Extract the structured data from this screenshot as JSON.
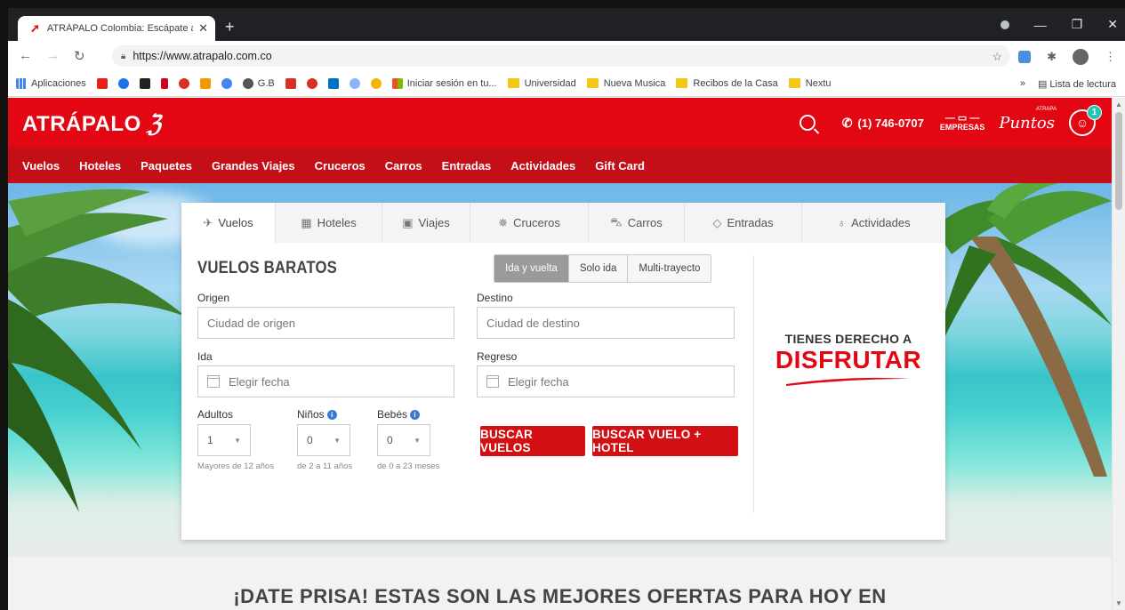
{
  "browser": {
    "tab_title": "ATRÁPALO Colombia: Escápate a",
    "tab_close": "✕",
    "new_tab": "+",
    "url": "https://www.atrapalo.com.co",
    "bookmarks": [
      {
        "label": "Aplicaciones",
        "color": "#4285f4"
      },
      {
        "label": "",
        "color": "#e62117"
      },
      {
        "label": "",
        "color": "#1a73e8"
      },
      {
        "label": "",
        "color": "#222222"
      },
      {
        "label": "",
        "color": "#d0021b"
      },
      {
        "label": "",
        "color": "#d93025"
      },
      {
        "label": "",
        "color": "#f29900"
      },
      {
        "label": "",
        "color": "#4285f4"
      },
      {
        "label": "G.B",
        "color": "#555555"
      },
      {
        "label": "",
        "color": "#d93025"
      },
      {
        "label": "",
        "color": "#d93025"
      },
      {
        "label": "",
        "color": "#0072c6"
      },
      {
        "label": "",
        "color": "#8ab4f8"
      },
      {
        "label": "",
        "color": "#f4b400"
      },
      {
        "label": "Iniciar sesión en tu...",
        "color": "#f25022"
      }
    ],
    "bookmark_folders": [
      "Universidad",
      "Nueva Musica",
      "Recibos de la Casa",
      "Nextu"
    ],
    "more_bookmarks": "»",
    "reading_list": "Lista de lectura"
  },
  "site": {
    "logo": "ATRÁPALO",
    "phone": "(1) 746-0707",
    "empresas": "EMPRESAS",
    "puntos": "Puntos",
    "puntos_sup": "ATRAPA",
    "notifications": "1",
    "nav": [
      "Vuelos",
      "Hoteles",
      "Paquetes",
      "Grandes Viajes",
      "Cruceros",
      "Carros",
      "Entradas",
      "Actividades",
      "Gift Card"
    ]
  },
  "widget": {
    "tabs": [
      {
        "label": "Vuelos",
        "icon": "plane-icon"
      },
      {
        "label": "Hoteles",
        "icon": "hotel-icon"
      },
      {
        "label": "Viajes",
        "icon": "suitcase-icon"
      },
      {
        "label": "Cruceros",
        "icon": "ship-wheel-icon"
      },
      {
        "label": "Carros",
        "icon": "car-icon"
      },
      {
        "label": "Entradas",
        "icon": "ticket-icon"
      },
      {
        "label": "Actividades",
        "icon": "pin-icon"
      }
    ],
    "title": "VUELOS BARATOS",
    "trip_types": [
      "Ida y vuelta",
      "Solo ida",
      "Multi-trayecto"
    ],
    "origin_label": "Origen",
    "origin_placeholder": "Ciudad de origen",
    "destination_label": "Destino",
    "destination_placeholder": "Ciudad de destino",
    "depart_label": "Ida",
    "depart_placeholder": "Elegir fecha",
    "return_label": "Regreso",
    "return_placeholder": "Elegir fecha",
    "adults_label": "Adultos",
    "adults_value": "1",
    "adults_hint": "Mayores de 12 años",
    "children_label": "Niños",
    "children_value": "0",
    "children_hint": "de 2 a 11 años",
    "babies_label": "Bebés",
    "babies_value": "0",
    "babies_hint": "de 0 a 23 meses",
    "search_button": "BUSCAR VUELOS",
    "search_hotel_button": "BUSCAR VUELO + HOTEL",
    "promo_line1": "TIENES DERECHO A",
    "promo_line2": "DISFRUTAR"
  },
  "offers_title": "¡DATE PRISA! ESTAS SON LAS MEJORES OFERTAS PARA HOY EN"
}
